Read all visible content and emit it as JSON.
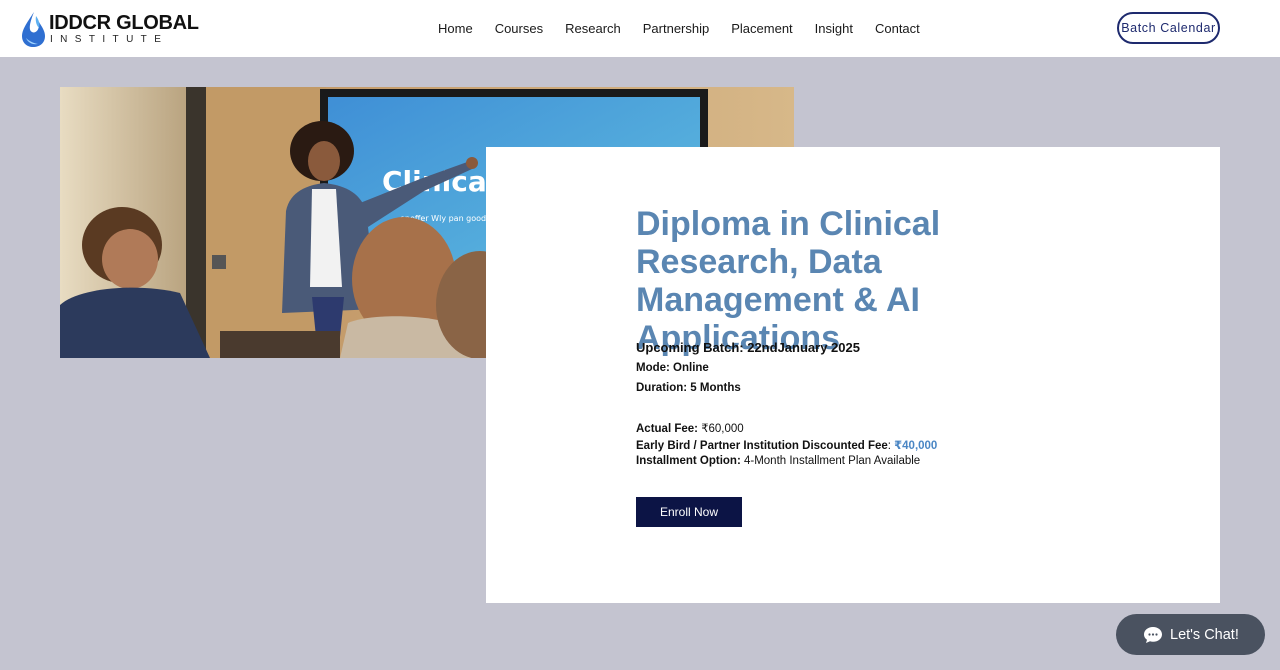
{
  "header": {
    "logo": {
      "title": "IDDCR GLOBAL",
      "subtitle": "INSTITUTE"
    },
    "nav": [
      "Home",
      "Courses",
      "Research",
      "Partnership",
      "Placement",
      "Insight",
      "Contact"
    ],
    "batch_calendar_label": "Batch Calendar"
  },
  "hero": {
    "image_alt": "Presenter pointing at a Clinical research slide on screen in front of an audience",
    "screen_title": "Clinical",
    "screen_caption": "eneffer Wly pan good r"
  },
  "course": {
    "title": "Diploma in Clinical Research, Data Management & AI Applications",
    "upcoming_batch": "Upcoming Batch: 22ndJanuary 2025",
    "mode": "Mode: Online",
    "duration": "Duration: 5 Months",
    "actual_fee_label": "Actual Fee:",
    "actual_fee_value": " ₹60,000",
    "discount_label": "Early Bird / Partner Institution Discounted Fee",
    "discount_sep": ": ",
    "discount_value": "₹40,000",
    "installment_label": "Installment Option:",
    "installment_value": " 4-Month Installment Plan Available",
    "enroll_label": "Enroll Now"
  },
  "chat": {
    "label": "Let's Chat!"
  },
  "colors": {
    "background": "#c4c4d0",
    "title_blue": "#5a86b2",
    "accent_blue": "#4a86c4",
    "navy": "#0c1445",
    "chat_bg": "#4a5260"
  }
}
